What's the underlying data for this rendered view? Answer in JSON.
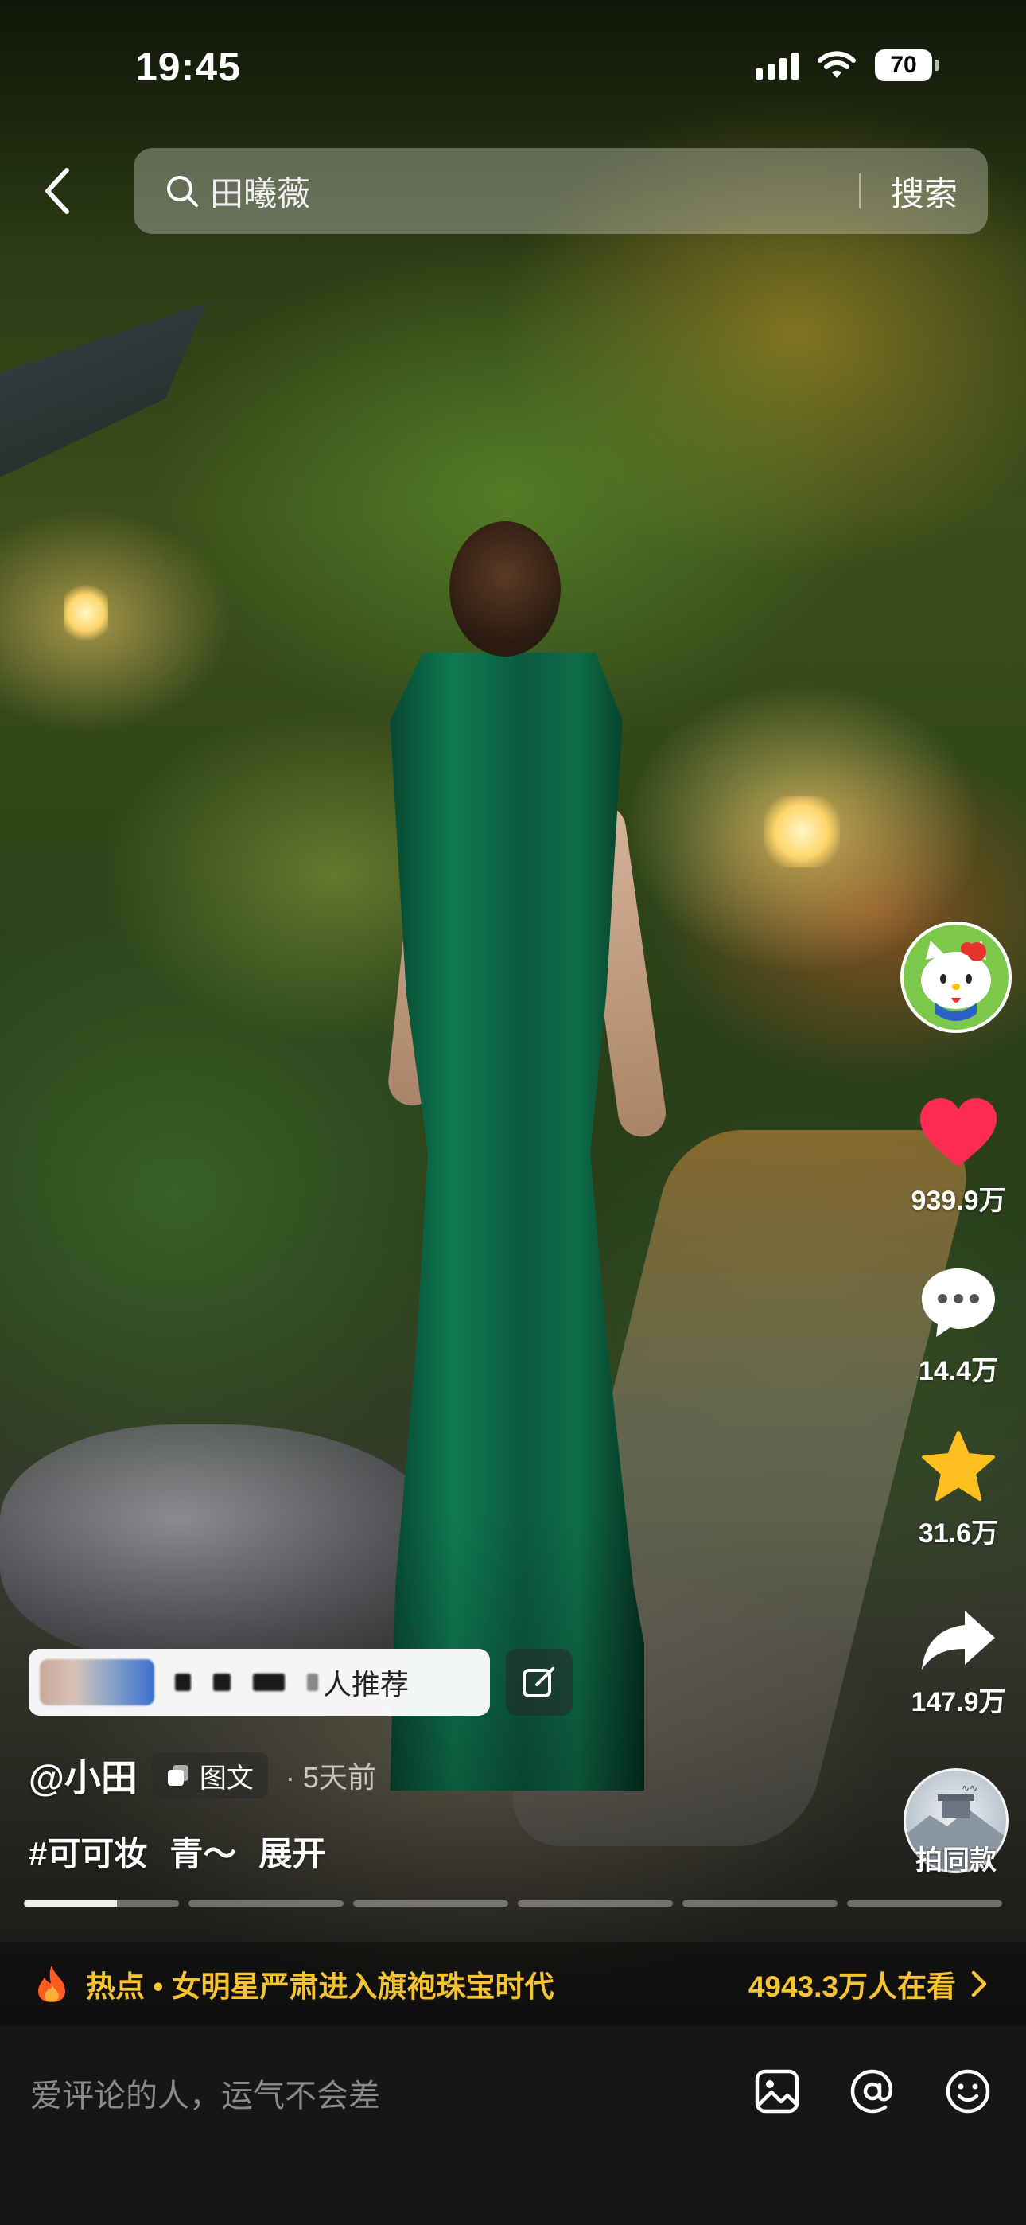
{
  "status_bar": {
    "time": "19:45",
    "battery": "70"
  },
  "search": {
    "query": "田曦薇",
    "button_label": "搜索"
  },
  "actions": {
    "likes": "939.9万",
    "comments": "14.4万",
    "favorites": "31.6万",
    "shares": "147.9万",
    "music_label": "拍同款"
  },
  "recommend": {
    "label": "人推荐"
  },
  "post": {
    "author": "@小田",
    "type_label": "图文",
    "time": "· 5天前",
    "hashtag": "#可可妆",
    "caption": "青～",
    "expand_label": "展开"
  },
  "progress": {
    "segments": 6,
    "current_index": 0,
    "current_fill": 0.6
  },
  "hot": {
    "text": "热点 • 女明星严肃进入旗袍珠宝时代",
    "count": "4943.3万人在看"
  },
  "comment": {
    "placeholder": "爱评论的人，运气不会差"
  },
  "colors": {
    "accent": "#f6c432",
    "like": "#fe2c55",
    "favorite": "#fcbf1e"
  }
}
